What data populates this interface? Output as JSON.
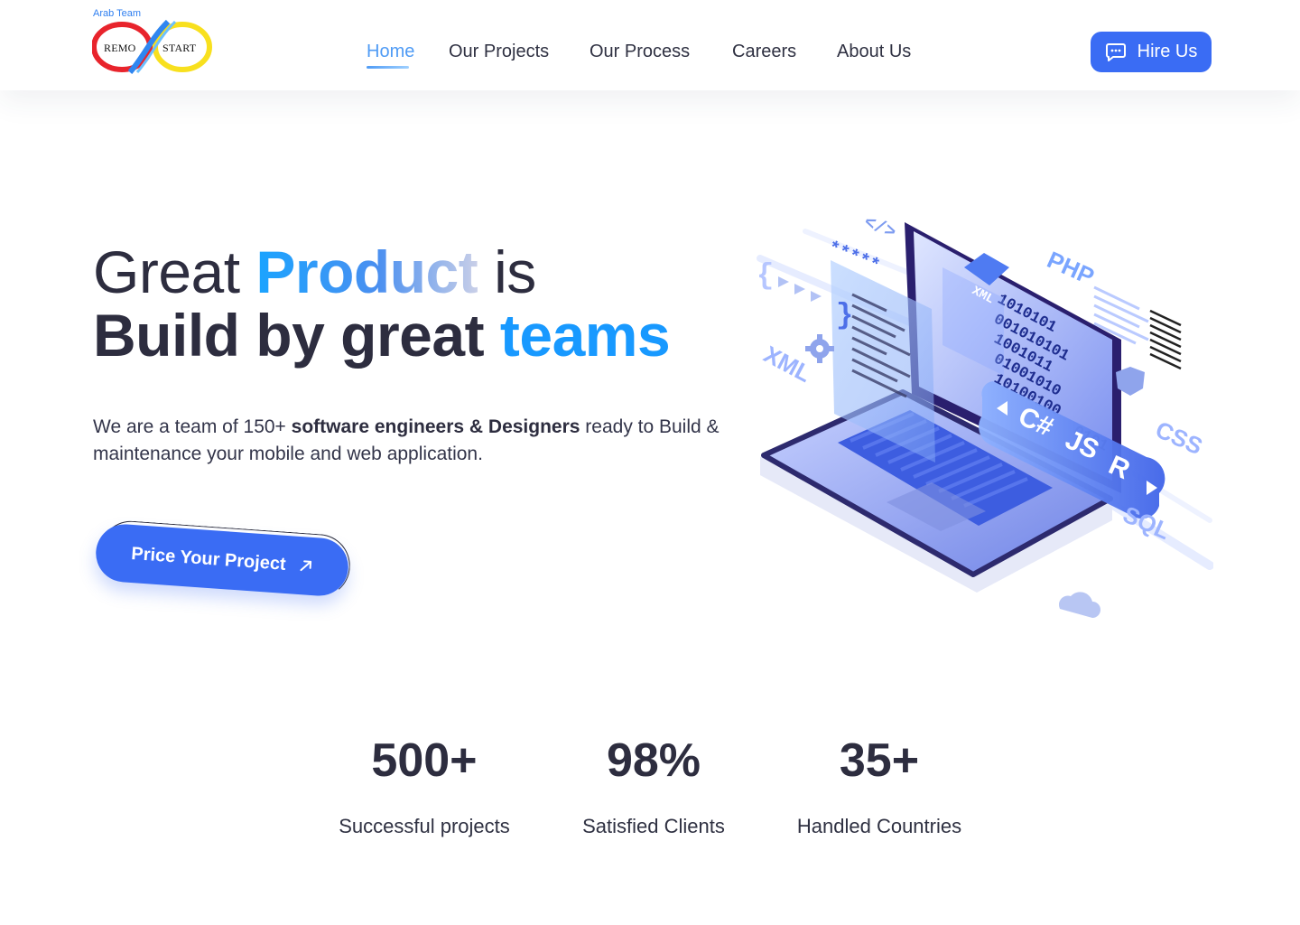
{
  "header": {
    "logo": {
      "tagline": "Arab Team",
      "left_word": "REMO",
      "right_word": "START"
    },
    "nav": [
      {
        "label": "Home",
        "active": true
      },
      {
        "label": "Our Projects",
        "active": false
      },
      {
        "label": "Our Process",
        "active": false
      },
      {
        "label": "Careers",
        "active": false
      },
      {
        "label": "About Us",
        "active": false
      }
    ],
    "hire_button": {
      "label": "Hire Us",
      "icon": "chat-bubble-icon"
    }
  },
  "hero": {
    "title_line1": {
      "text1": "Great ",
      "highlight": "Product",
      "text2": " is"
    },
    "title_line2": {
      "text1": "Build by great ",
      "highlight": "teams"
    },
    "description": {
      "part1": "We are a team of 150+ ",
      "bold": "software engineers & Designers",
      "part2": " ready to Build & maintenance your mobile and web application."
    },
    "cta": {
      "label": "Price Your Project",
      "icon": "arrow-up-right-icon"
    },
    "illustration": {
      "labels": [
        "PHP",
        "XML",
        "CSS",
        "SQL",
        "C#",
        "JS",
        "R",
        "*****",
        "</>",
        "{",
        "}"
      ],
      "binary_rows": [
        "1010101",
        "001010101",
        "1001011",
        "01001010",
        "10100100",
        "0101"
      ]
    }
  },
  "stats": [
    {
      "value": "500+",
      "label": "Successful projects"
    },
    {
      "value": "98%",
      "label": "Satisfied Clients"
    },
    {
      "value": "35+",
      "label": "Handled Countries"
    }
  ],
  "colors": {
    "primary": "#3a6cf4",
    "nav_active": "#4f9bf5",
    "heading": "#2d2d3f",
    "highlight_blue": "#1899ff"
  }
}
